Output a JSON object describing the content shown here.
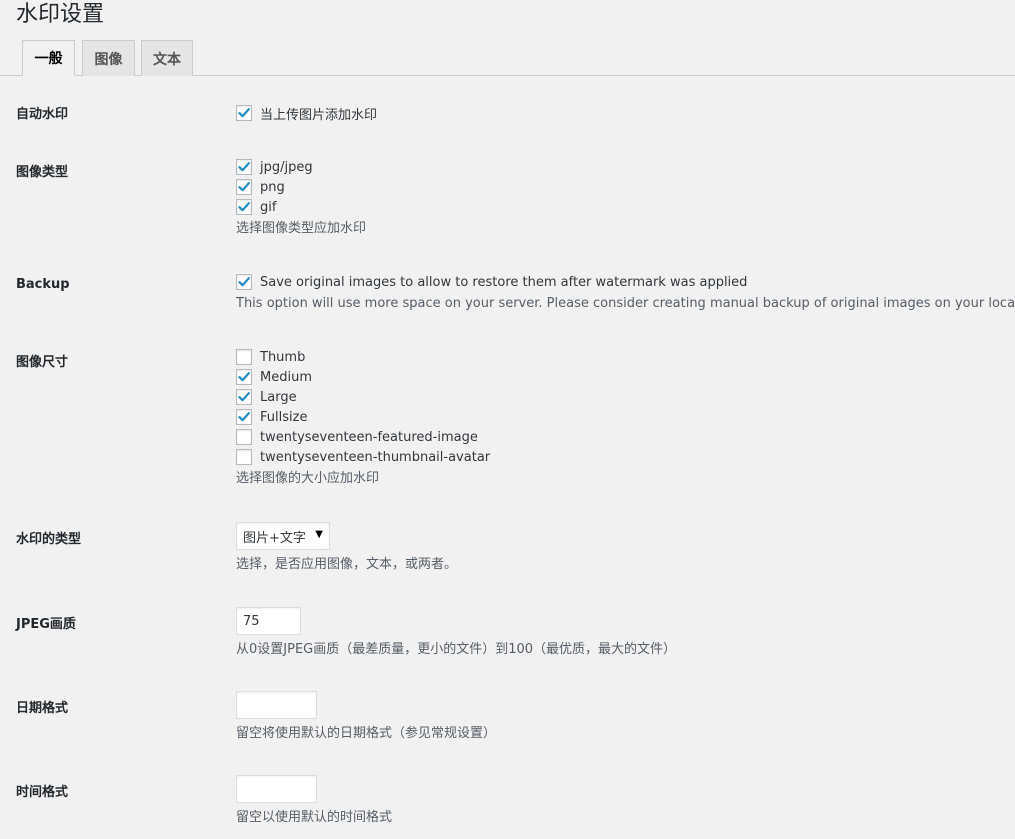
{
  "page": {
    "title": "水印设置"
  },
  "tabs": [
    {
      "label": "一般",
      "active": true
    },
    {
      "label": "图像",
      "active": false
    },
    {
      "label": "文本",
      "active": false
    }
  ],
  "auto_watermark": {
    "label": "自动水印",
    "option": {
      "text": "当上传图片添加水印",
      "checked": true
    }
  },
  "image_types": {
    "label": "图像类型",
    "options": [
      {
        "text": "jpg/jpeg",
        "checked": true
      },
      {
        "text": "png",
        "checked": true
      },
      {
        "text": "gif",
        "checked": true
      }
    ],
    "description": "选择图像类型应加水印"
  },
  "backup": {
    "label": "Backup",
    "option": {
      "text": "Save original images to allow to restore them after watermark was applied",
      "checked": true
    },
    "description": "This option will use more space on your server. Please consider creating manual backup of original images on your local drive."
  },
  "image_sizes": {
    "label": "图像尺寸",
    "options": [
      {
        "text": "Thumb",
        "checked": false
      },
      {
        "text": "Medium",
        "checked": true
      },
      {
        "text": "Large",
        "checked": true
      },
      {
        "text": "Fullsize",
        "checked": true
      },
      {
        "text": "twentyseventeen-featured-image",
        "checked": false
      },
      {
        "text": "twentyseventeen-thumbnail-avatar",
        "checked": false
      }
    ],
    "description": "选择图像的大小应加水印"
  },
  "watermark_type": {
    "label": "水印的类型",
    "selected": "图片+文字",
    "description": "选择，是否应用图像，文本，或两者。"
  },
  "jpeg_quality": {
    "label": "JPEG画质",
    "value": "75",
    "description": "从0设置JPEG画质（最差质量，更小的文件）到100（最优质，最大的文件）"
  },
  "date_format": {
    "label": "日期格式",
    "value": "",
    "description": "留空将使用默认的日期格式（参见常规设置）"
  },
  "time_format": {
    "label": "时间格式",
    "value": "",
    "description": "留空以使用默认的时间格式"
  },
  "colors": {
    "accent": "#1e8cbe",
    "background": "#f1f1f1"
  }
}
